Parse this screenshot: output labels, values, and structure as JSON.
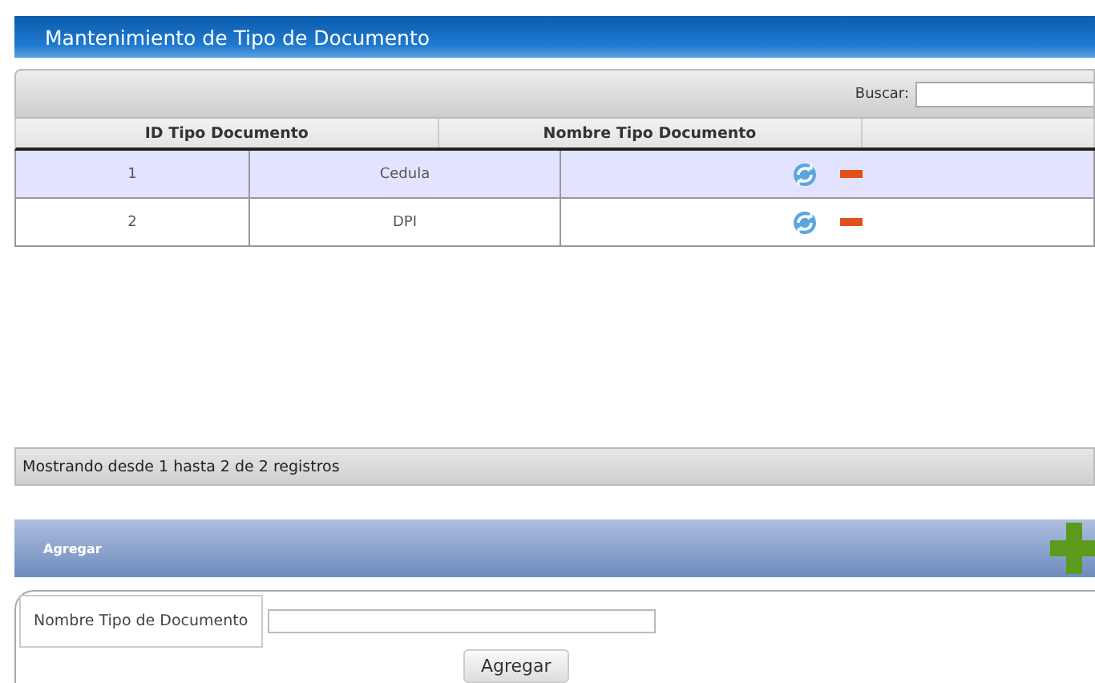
{
  "title": "Mantenimiento de Tipo de Documento",
  "search": {
    "label": "Buscar:"
  },
  "table": {
    "columns": [
      "ID Tipo Documento",
      "Nombre Tipo Documento"
    ],
    "rows": [
      {
        "id": "1",
        "name": "Cedula",
        "selected": true
      },
      {
        "id": "2",
        "name": "DPI",
        "selected": false
      }
    ]
  },
  "footer": "Mostrando desde 1 hasta 2 de 2 registros",
  "add_panel": {
    "title": "Agregar",
    "field_label": "Nombre Tipo de Documento",
    "button": "Agregar"
  }
}
